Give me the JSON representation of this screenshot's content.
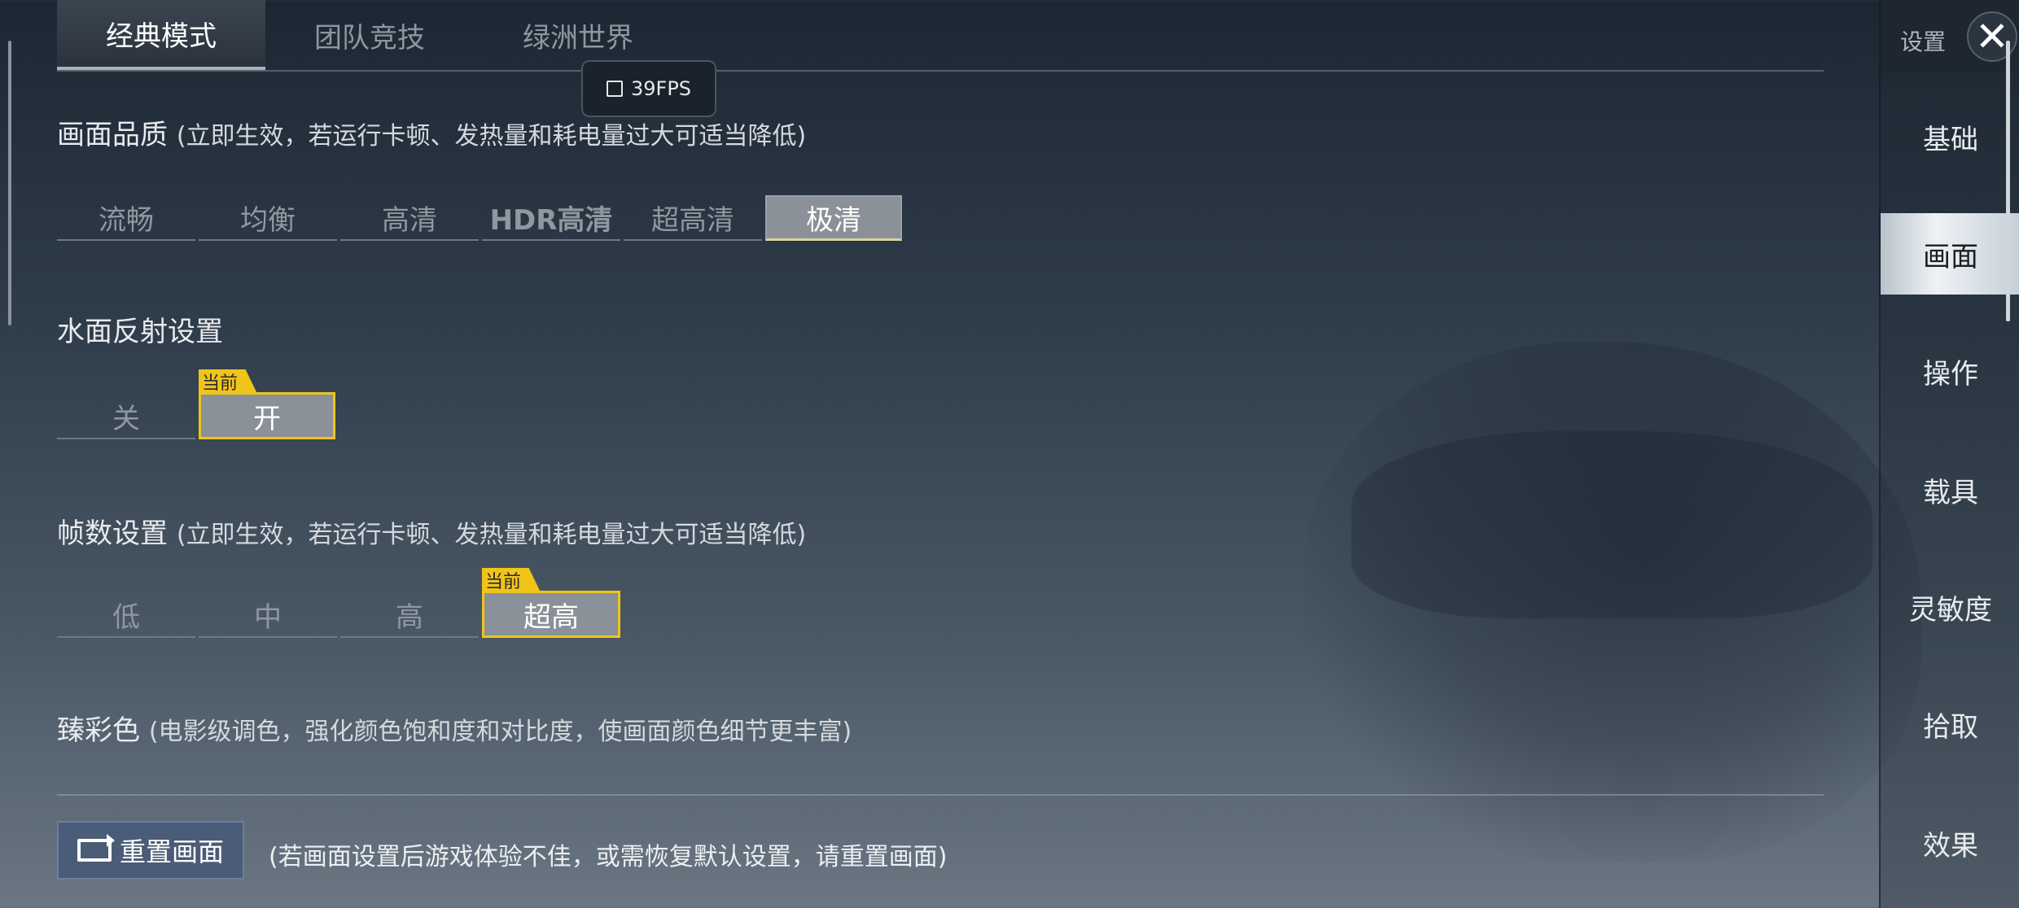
{
  "top_tabs": [
    {
      "label": "经典模式",
      "active": true
    },
    {
      "label": "团队竞技",
      "active": false
    },
    {
      "label": "绿洲世界",
      "active": false
    }
  ],
  "fps": "39FPS",
  "quality": {
    "title": "画面品质",
    "note": "(立即生效，若运行卡顿、发热量和耗电量过大可适当降低)",
    "options": [
      "流畅",
      "均衡",
      "高清",
      "HDR高清",
      "超高清",
      "极清"
    ],
    "selected": "极清"
  },
  "water": {
    "title": "水面反射设置",
    "options": [
      "关",
      "开"
    ],
    "selected": "开",
    "current_badge": "当前"
  },
  "framerate": {
    "title": "帧数设置",
    "note": "(立即生效，若运行卡顿、发热量和耗电量过大可适当降低)",
    "options": [
      "低",
      "中",
      "高",
      "超高"
    ],
    "selected": "超高",
    "current_badge": "当前"
  },
  "color": {
    "title": "臻彩色",
    "note": "(电影级调色，强化颜色饱和度和对比度，使画面颜色细节更丰富)"
  },
  "reset": {
    "label": "重置画面",
    "note": "(若画面设置后游戏体验不佳，或需恢复默认设置，请重置画面)"
  },
  "sidebar": {
    "header": "设置",
    "close_glyph": "✕",
    "items": [
      {
        "label": "基础",
        "active": false
      },
      {
        "label": "画面",
        "active": true
      },
      {
        "label": "操作",
        "active": false
      },
      {
        "label": "载具",
        "active": false
      },
      {
        "label": "灵敏度",
        "active": false
      },
      {
        "label": "拾取",
        "active": false
      },
      {
        "label": "效果",
        "active": false
      }
    ]
  },
  "colors": {
    "accent_yellow": "#f0c419",
    "selected_gray": "#8a9199",
    "reset_blue": "#4b5c78"
  }
}
